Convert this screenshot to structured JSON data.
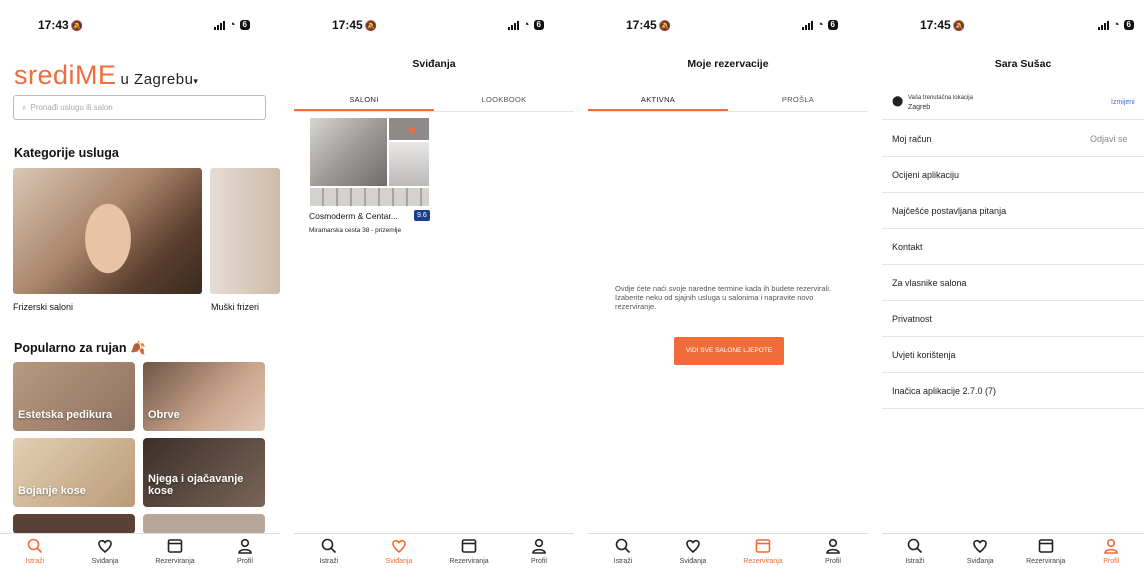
{
  "status_bar": {
    "time_1": "17:43",
    "time_2": "17:45",
    "battery": "6"
  },
  "screen1": {
    "logo": "srediME",
    "city": "u Zagrebu",
    "search_placeholder": "Pronađi uslugu ili salon",
    "categories_title": "Kategorije usluga",
    "categories": [
      "Frizerski saloni",
      "Muški frizeri"
    ],
    "popular_title": "Popularno za rujan",
    "popular_tiles": [
      "Estetska pedikura",
      "Obrve",
      "Bojanje kose",
      "Njega i ojačavanje kose"
    ]
  },
  "screen2": {
    "title": "Sviđanja",
    "tabs": [
      "SALONI",
      "LOOKBOOK"
    ],
    "salon": {
      "name": "Cosmoderm & Centar...",
      "rating": "9.6",
      "address": "Miramarska cesta 38 - prizemlje"
    }
  },
  "screen3": {
    "title": "Moje rezervacije",
    "tabs": [
      "AKTIVNA",
      "PROŠLA"
    ],
    "empty_text": "Ovdje ćete naći svoje naredne termine kada ih budete rezervirali. Izaberite neku od sjajnih usluga u salonima i napravite novo rezerviranje.",
    "cta": "VIDI SVE SALONE LJEPOTE"
  },
  "screen4": {
    "title": "Sara Sušac",
    "location_label": "Vaša trenutačna lokacija",
    "location_value": "Zagreb",
    "location_change": "Izmijeni",
    "account": "Moj račun",
    "logout": "Odjavi se",
    "menu": [
      "Ocijeni aplikaciju",
      "Najčešće postavljana pitanja",
      "Kontakt",
      "Za vlasnike salona",
      "Privatnost",
      "Uvjeti korištenja",
      "Inačica aplikacije 2.7.0 (7)"
    ]
  },
  "tabbar": [
    "Istraži",
    "Sviđanja",
    "Rezerviranja",
    "Profil"
  ],
  "colors": {
    "accent": "#f06c3b",
    "rating_bg": "#1b3f8f",
    "link": "#3a6fd8"
  }
}
